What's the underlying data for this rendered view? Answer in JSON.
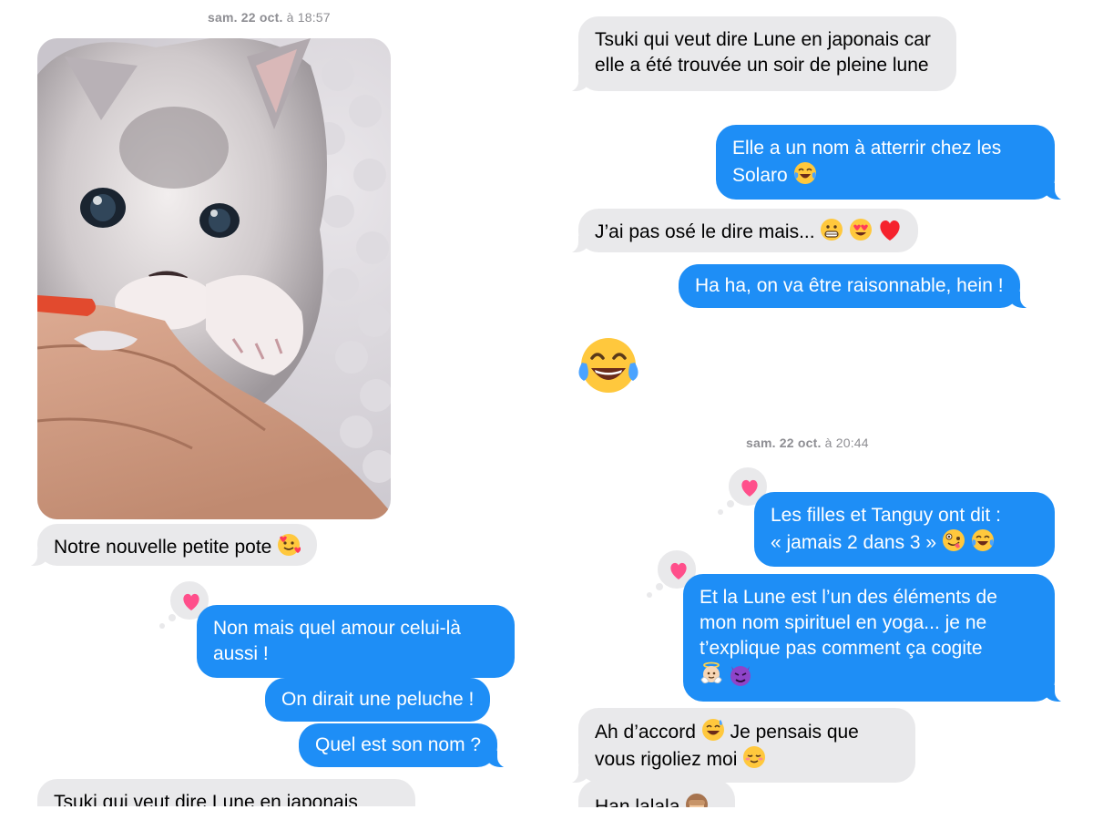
{
  "left": {
    "timestamp_day": "sam. 22 oct.",
    "timestamp_time": "à 18:57",
    "photo_caption": "Notre nouvelle petite pote",
    "msg_out_1": "Non mais quel amour celui-là aussi !",
    "msg_out_2": "On dirait une peluche !",
    "msg_out_3": "Quel est son nom ?",
    "msg_in_cut": "Tsuki qui veut dire Lune en japonais"
  },
  "right": {
    "msg_in_1": "Tsuki qui veut dire Lune en japonais car elle a été trouvée un soir de pleine lune",
    "msg_out_1": "Elle a un nom à atterrir chez les Solaro",
    "msg_in_2": "J’ai pas osé le dire mais...",
    "msg_out_2": "Ha ha, on va être raisonnable, hein !",
    "timestamp_day": "sam. 22 oct.",
    "timestamp_time": "à 20:44",
    "msg_out_3_line1": "Les filles et Tanguy ont dit :",
    "msg_out_3_line2": "« jamais 2 dans 3 »",
    "msg_out_4": "Et la Lune est l’un des éléments de mon nom spirituel en yoga... je ne t’explique pas comment ça cogite",
    "msg_in_3_a": "Ah d’accord",
    "msg_in_3_b": "Je pensais que vous rigoliez moi",
    "msg_in_4_cut": "Han lalala"
  },
  "icons": [
    "smiling-face-with-hearts-emoji",
    "heart-tapback-icon",
    "tears-of-joy-emoji",
    "grimacing-emoji",
    "heart-eyes-emoji",
    "red-heart-emoji",
    "zany-face-emoji",
    "baby-angel-emoji",
    "smiling-imp-emoji",
    "grinning-sweat-emoji",
    "relieved-smile-emoji",
    "see-no-evil-monkey-emoji"
  ],
  "colors": {
    "incoming_bubble": "#e9e9eb",
    "outgoing_bubble": "#1e8ef6",
    "timestamp": "#8e8e93",
    "tapback_heart": "#ff4f8b"
  }
}
